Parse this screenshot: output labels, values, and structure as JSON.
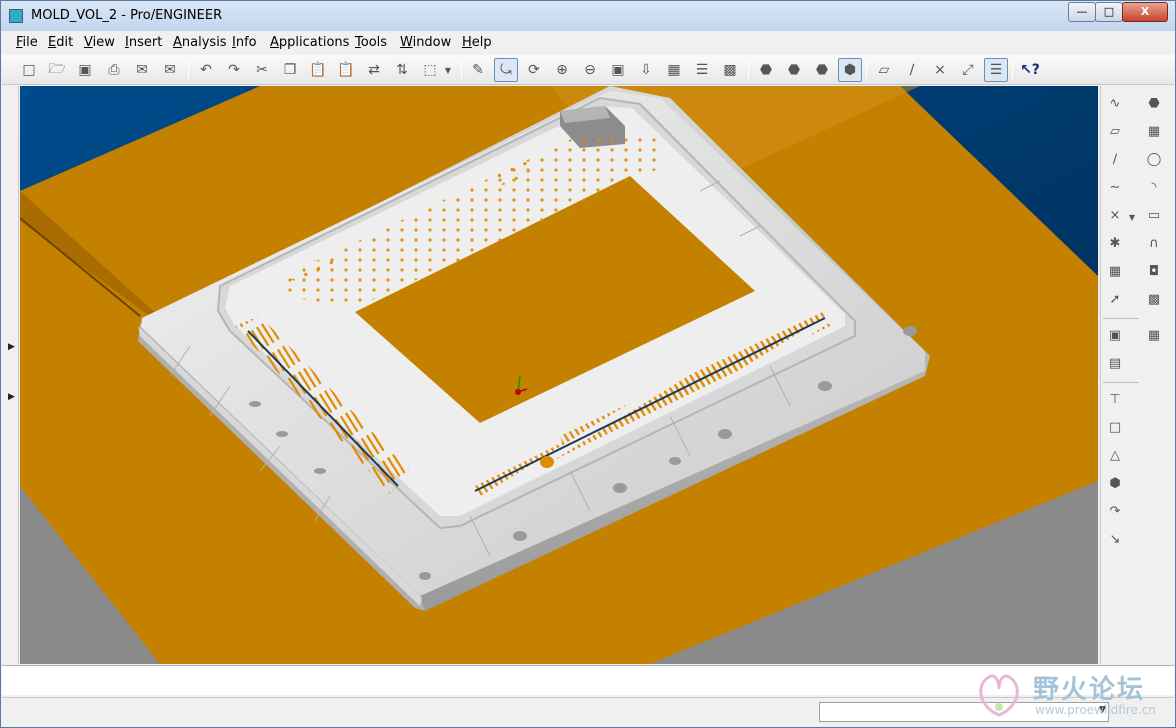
{
  "window": {
    "title": "MOLD_VOL_2 - Pro/ENGINEER",
    "min_label": "—",
    "max_label": "□",
    "close_label": "X"
  },
  "menu": [
    "File",
    "Edit",
    "View",
    "Insert",
    "Analysis",
    "Info",
    "Applications",
    "Tools",
    "Window",
    "Help"
  ],
  "toolbar": {
    "icons": [
      "new-file-icon",
      "open-icon",
      "save-icon",
      "print-icon",
      "email-icon",
      "email-link-icon",
      "undo-icon",
      "redo-icon",
      "cut-icon",
      "copy-icon",
      "paste-icon",
      "paste-special-icon",
      "regenerate-icon",
      "regen-manager-icon",
      "selection-box-icon",
      "dropdown-icon",
      "repaint-icon",
      "spin-center-icon",
      "orient-icon",
      "zoom-in-icon",
      "zoom-out-icon",
      "refit-icon",
      "reorient-icon",
      "saved-views-icon",
      "layers-icon",
      "view-manager-icon",
      "wireframe-icon",
      "hidden-line-icon",
      "no-hidden-icon",
      "shading-icon",
      "datum-planes-icon",
      "datum-axes-icon",
      "datum-points-icon",
      "coordinate-systems-icon",
      "annotations-icon",
      "whats-this-icon"
    ]
  },
  "right_toolbar": {
    "icons": [
      "sketch-icon",
      "plane-icon",
      "axis-icon",
      "curve-icon",
      "point-icon",
      "csys-icon",
      "analysis-icon",
      "reference-icon",
      "mold-component-icon",
      "workpiece-icon",
      "shrinkage-icon",
      "parting-surface-icon",
      "volume-split-icon",
      "mold-volume-icon",
      "runner-icon",
      "water-line-icon",
      "cavity-layout-icon",
      "extrude-icon",
      "revolve-icon",
      "sweep-icon",
      "blend-icon",
      "round-icon",
      "chamfer-icon",
      "draft-icon"
    ]
  },
  "status": {
    "filter_value": "",
    "message": ""
  },
  "watermark": {
    "text": "野火论坛",
    "url": "www.proewildfire.cn"
  },
  "colors": {
    "viewport_bg": "#00305c",
    "workpiece": "#c48100",
    "part_surface": "#e2e2e2",
    "gray_base": "#8a8a8a",
    "accent_hole": "#e08a00"
  }
}
